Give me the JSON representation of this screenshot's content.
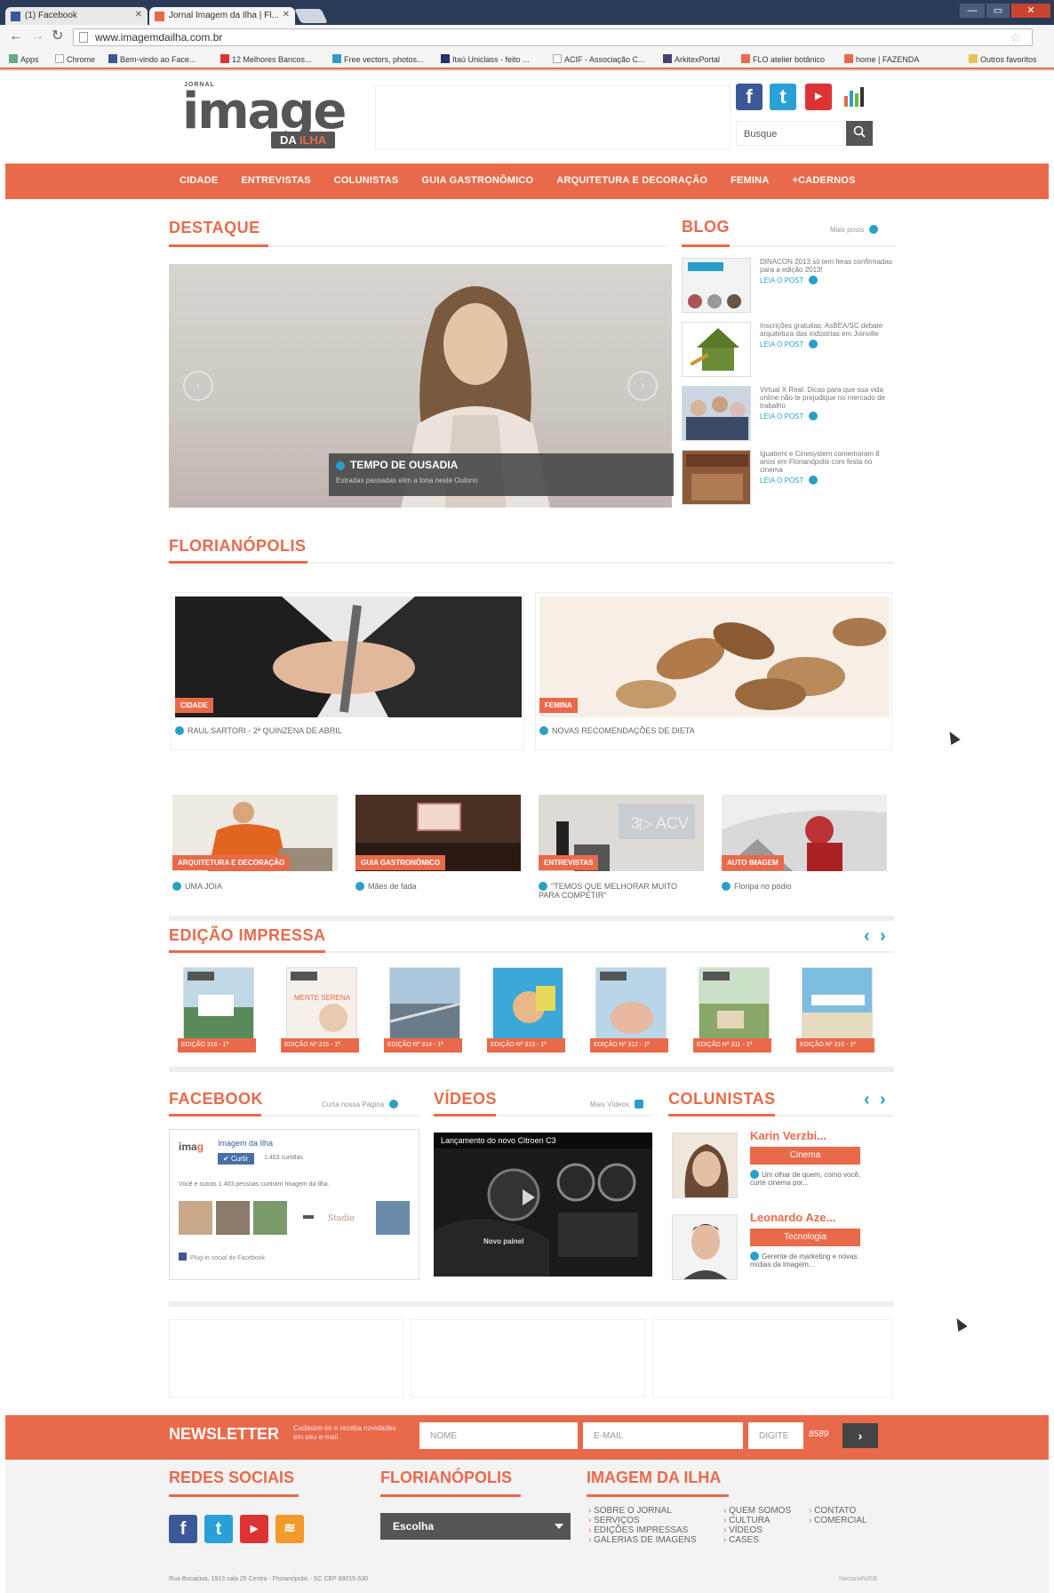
{
  "browser": {
    "tabs": [
      {
        "label": "(1) Facebook"
      },
      {
        "label": "Jornal Imagem da Ilha | Fl..."
      }
    ],
    "url": "www.imagemdailha.com.br",
    "bookmarks": [
      "Apps",
      "Chrome",
      "Bem-vindo ao Face...",
      "12 Melhores Bancos...",
      "Free vectors, photos...",
      "Itaú Uniclass - feito ...",
      "ACIF - Associação C...",
      "ArkitexPortal",
      "FLO atelier botânico",
      "home | FAZENDA",
      "Outros favoritos"
    ],
    "controls": {
      "min": "—",
      "max": "▭",
      "close": "✕"
    }
  },
  "header": {
    "logo": {
      "small": "JORNAL",
      "main": "image",
      "sub_prefix": "DA",
      "sub": "ILHA"
    },
    "search_placeholder": "Busque",
    "social_icons": [
      "facebook-icon",
      "twitter-icon",
      "youtube-icon",
      "stats-icon"
    ]
  },
  "nav": {
    "items": [
      "CIDADE",
      "ENTREVISTAS",
      "COLUNISTAS",
      "GUIA GASTRONÔMICO",
      "ARQUITETURA E DECORAÇÃO",
      "FEMINA",
      "+CADERNOS"
    ]
  },
  "destaque": {
    "title": "DESTAQUE",
    "slide": {
      "title": "TEMPO DE OUSADIA",
      "subtitle": "Estradas passadas elim a tona neste Outono"
    }
  },
  "blog": {
    "title": "BLOG",
    "more": "Mais posts",
    "posts": [
      {
        "text": "DINACON 2013 só tem feras confirmadas para a edição 2013!",
        "read": "LEIA O POST"
      },
      {
        "text": "Inscrições gratuitas: AsBEA/SC debate arquitetura das indústrias em Joinville",
        "read": "LEIA O POST"
      },
      {
        "text": "Virtual X Real: Dicas para que sua vida online não te prejudique no mercado de trabalho",
        "read": "LEIA O POST"
      },
      {
        "text": "Iguatemi e Cinesystem comemoram 8 anos em Florianópolis com festa no cinema",
        "read": "LEIA O POST"
      }
    ]
  },
  "florianopolis": {
    "title": "FLORIANÓPOLIS",
    "big": [
      {
        "tag": "CIDADE",
        "caption": "RAUL SARTORI - 2ª QUINZENA DE ABRIL"
      },
      {
        "tag": "FEMINA",
        "caption": "NOVAS RECOMENDAÇÕES DE DIETA"
      }
    ],
    "small": [
      {
        "tag": "ARQUITETURA E DECORAÇÃO",
        "caption": "UMA JOIA"
      },
      {
        "tag": "GUIA GASTRONÔMICO",
        "caption": "Mães de fada"
      },
      {
        "tag": "ENTREVISTAS",
        "caption": "\"TEMOS QUE MELHORAR MUITO PARA COMPETIR\""
      },
      {
        "tag": "AUTO IMAGEM",
        "caption": "Floripa no pódio"
      }
    ]
  },
  "edicao": {
    "title": "EDIÇÃO IMPRESSA",
    "prev": "‹",
    "next": "›",
    "items": [
      "EDIÇÃO 316 - 1ª",
      "EDIÇÃO Nº 315 - 1ª",
      "EDIÇÃO Nº 314 - 1ª",
      "EDIÇÃO Nº 313 - 1ª",
      "EDIÇÃO Nº 312 - 1ª",
      "EDIÇÃO Nº 311 - 1ª",
      "EDIÇÃO Nº 310 - 1ª"
    ]
  },
  "facebook": {
    "title": "FACEBOOK",
    "more": "Curta nossa Página",
    "page_name": "Imagem da Ilha",
    "like": "Curtir",
    "likes_count": "1.403 curtidas",
    "friends_text": "Você e outras 1.403 pessoas curtiram Imagem da Ilha.",
    "plugin": "Plug-in social do Facebook"
  },
  "videos": {
    "title": "VÍDEOS",
    "more": "Mais Vídeos",
    "video_title": "Lançamento do novo Citroen C3",
    "overlay": "Novo painel"
  },
  "colunistas": {
    "title": "COLUNISTAS",
    "items": [
      {
        "name": "Karin Verzbi...",
        "category": "Cinema",
        "text": "Um olhar de quem, como você, curte cinema por..."
      },
      {
        "name": "Leonardo Aze...",
        "category": "Tecnologia",
        "text": "Gerente de marketing e novas mídias da Imagem..."
      }
    ]
  },
  "newsletter": {
    "title": "NEWSLETTER",
    "subtitle": "Cadastre-se e receba novidades em seu e-mail",
    "name_placeholder": "NOME",
    "email_placeholder": "E-MAIL",
    "captcha_placeholder": "DIGITE",
    "captcha_code": "8589",
    "submit": "›"
  },
  "footer": {
    "redes_title": "REDES SOCIAIS",
    "floripa_title": "FLORIANÓPOLIS",
    "select_value": "Escolha",
    "imagem_title": "IMAGEM DA ILHA",
    "links_col1": [
      "SOBRE O JORNAL",
      "SERVIÇOS",
      "EDIÇÕES IMPRESSAS",
      "GALERIAS DE IMAGENS"
    ],
    "links_col2": [
      "QUEM SOMOS",
      "CULTURA",
      "VÍDEOS",
      "CASES"
    ],
    "links_col3": [
      "CONTATO",
      "COMERCIAL"
    ],
    "address": "Rua Bocaiúva, 1913 sala 25 Centro - Florianópolis - SC CEP 88015-530",
    "credit": "NacionalWEB"
  },
  "colors": {
    "accent": "#e96a4a",
    "link": "#2aa0c8",
    "dark": "#555555"
  }
}
